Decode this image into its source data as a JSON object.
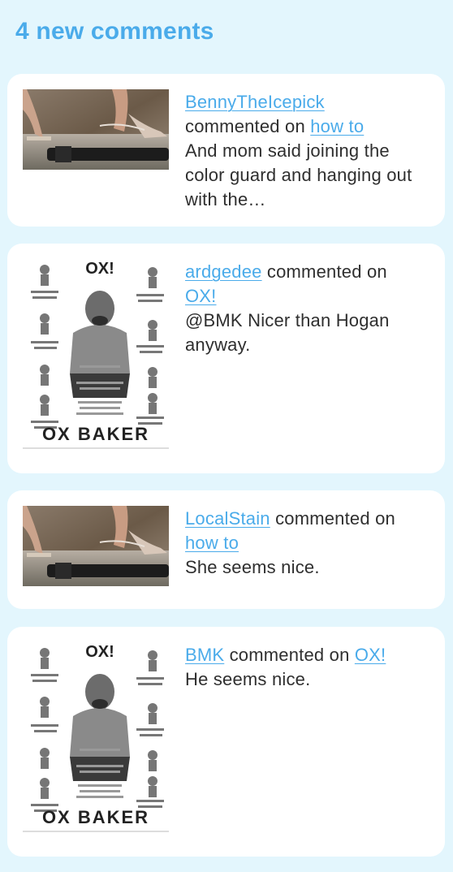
{
  "header": {
    "title": "4 new comments"
  },
  "comments": [
    {
      "user": "BennyTheIcepick",
      "verb": "commented on",
      "post": "how to",
      "body": "And mom said joining the color guard and hanging out with the…",
      "thumbnail_icon": "heels-on-gun-thumbnail"
    },
    {
      "user": "ardgedee",
      "verb": "commented on",
      "post": "OX!",
      "body": "@BMK Nicer than Hogan anyway.",
      "thumbnail_icon": "ox-baker-poster-thumbnail",
      "poster": {
        "title": "OX!",
        "footer": "OX BAKER"
      }
    },
    {
      "user": "LocalStain",
      "verb": "commented on",
      "post": "how to",
      "body": "She seems nice.",
      "thumbnail_icon": "heels-on-gun-thumbnail"
    },
    {
      "user": "BMK",
      "verb": "commented on",
      "post": "OX!",
      "body": "He seems nice.",
      "thumbnail_icon": "ox-baker-poster-thumbnail",
      "poster": {
        "title": "OX!",
        "footer": "OX BAKER"
      }
    }
  ],
  "colors": {
    "background": "#e3f6fd",
    "card": "#ffffff",
    "accent": "#4aabea",
    "text": "#2f2f2f"
  }
}
